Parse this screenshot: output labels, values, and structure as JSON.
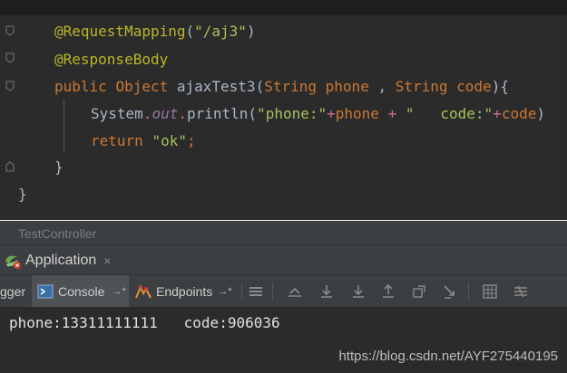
{
  "editor": {
    "lines": [
      {
        "annotation": "@RequestMapping",
        "paren_open": "(",
        "string": "\"/aj3\"",
        "paren_close": ")"
      },
      {
        "annotation": "@ResponseBody"
      },
      {
        "kw_public": "public",
        "type": "Object",
        "method": "ajaxTest3",
        "paren_open": "(",
        "ptype1": "String",
        "param1": "phone",
        "comma": " , ",
        "ptype2": "String",
        "param2": "code",
        "tail": "){"
      },
      {
        "cls": "System",
        "dot1": ".",
        "field": "out",
        "dot2": ".",
        "call": "println",
        "paren_open": "(",
        "str1": "\"phone:\"",
        "op1": "+",
        "var1": "phone",
        "op2": " + ",
        "str2": "\"   code:\"",
        "op3": "+",
        "var2": "code",
        "tail": ")"
      },
      {
        "kw_return": "return",
        "string": "\"ok\"",
        "semi": ";"
      },
      {
        "brace": "}"
      },
      {
        "brace": "}"
      }
    ]
  },
  "breadcrumb": {
    "label": "TestController"
  },
  "run_panel": {
    "app_tab": {
      "label": "Application",
      "close": "×"
    },
    "toolbar": {
      "debugger_label": "gger",
      "console_label": "Console",
      "console_pin": "→*",
      "endpoints_label": "Endpoints",
      "endpoints_pin": "→*"
    },
    "console_output": "phone:13311111111   code:906036"
  },
  "watermark": "https://blog.csdn.net/AYF275440195",
  "colors": {
    "editor_bg": "#2b2b2b",
    "annotation": "#bbb529",
    "string": "#a5c25c",
    "keyword": "#cc7832",
    "field": "#9876aa"
  }
}
